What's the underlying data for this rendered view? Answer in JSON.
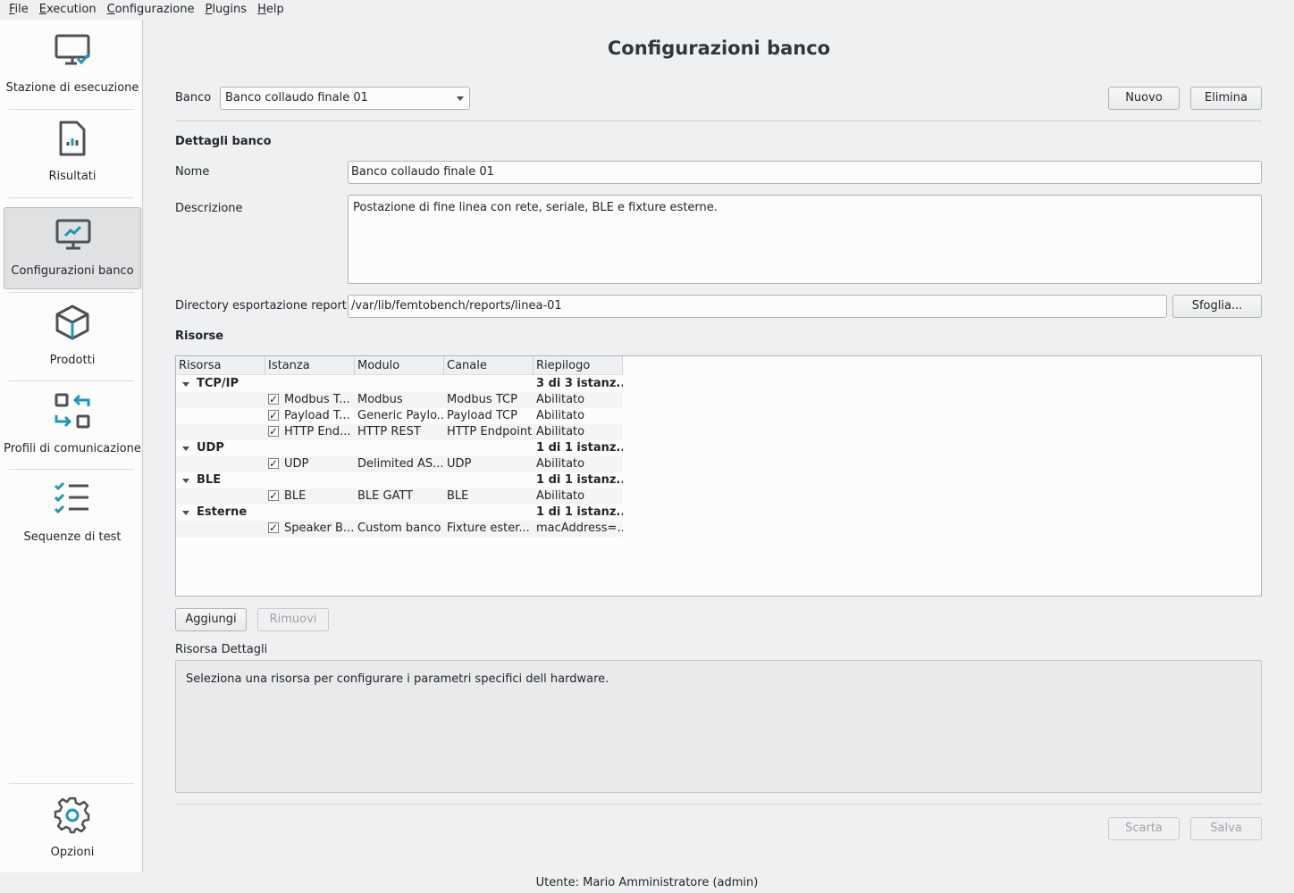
{
  "menu": [
    {
      "label": "File",
      "u": "F",
      "rest": "ile"
    },
    {
      "label": "Execution",
      "u": "E",
      "rest": "xecution"
    },
    {
      "label": "Configurazione",
      "u": "C",
      "rest": "onfigurazione"
    },
    {
      "label": "Plugins",
      "u": "P",
      "rest": "lugins"
    },
    {
      "label": "Help",
      "u": "H",
      "rest": "elp"
    }
  ],
  "sidebar": {
    "items": [
      {
        "label": "Stazione di esecuzione",
        "icon": "monitor-check-icon"
      },
      {
        "label": "Risultati",
        "icon": "report-chart-icon"
      },
      {
        "label": "Configurazioni banco",
        "icon": "monitor-chart-icon",
        "active": true
      },
      {
        "label": "Prodotti",
        "icon": "box-icon"
      },
      {
        "label": "Profili di comunicazione",
        "icon": "swap-arrows-icon"
      },
      {
        "label": "Sequenze di test",
        "icon": "checklist-icon"
      }
    ],
    "options": {
      "label": "Opzioni",
      "icon": "gear-icon"
    }
  },
  "main": {
    "title": "Configurazioni banco",
    "banco_label": "Banco",
    "banco_value": "Banco collaudo finale 01",
    "btn_new": "Nuovo",
    "btn_delete": "Elimina",
    "details_title": "Dettagli banco",
    "name_label": "Nome",
    "name_value": "Banco collaudo finale 01",
    "desc_label": "Descrizione",
    "desc_value": "Postazione di fine linea con rete, seriale, BLE e fixture esterne.",
    "export_label": "Directory esportazione report",
    "export_value": "/var/lib/femtobench/reports/linea-01",
    "btn_browse": "Sfoglia...",
    "resources_title": "Risorse",
    "columns": [
      "Risorsa",
      "Istanza",
      "Modulo",
      "Canale",
      "Riepilogo"
    ],
    "groups": [
      {
        "name": "TCP/IP",
        "summary": "3 di 3 istanz...",
        "children": [
          {
            "instance": "Modbus T...",
            "module": "Modbus",
            "channel": "Modbus TCP",
            "summary": "Abilitato"
          },
          {
            "instance": "Payload T...",
            "module": "Generic Paylo...",
            "channel": "Payload TCP",
            "summary": "Abilitato"
          },
          {
            "instance": "HTTP End...",
            "module": "HTTP REST",
            "channel": "HTTP Endpoint",
            "summary": "Abilitato"
          }
        ]
      },
      {
        "name": "UDP",
        "summary": "1 di 1 istanz...",
        "children": [
          {
            "instance": "UDP",
            "module": "Delimited AS...",
            "channel": "UDP",
            "summary": "Abilitato"
          }
        ]
      },
      {
        "name": "BLE",
        "summary": "1 di 1 istanz...",
        "children": [
          {
            "instance": "BLE",
            "module": "BLE GATT",
            "channel": "BLE",
            "summary": "Abilitato"
          }
        ]
      },
      {
        "name": "Esterne",
        "summary": "1 di 1 istanz...",
        "children": [
          {
            "instance": "Speaker B...",
            "module": "Custom banco",
            "channel": "Fixture ester...",
            "summary": "macAddress=..."
          }
        ]
      }
    ],
    "btn_add": "Aggiungi",
    "btn_remove": "Rimuovi",
    "res_details_label": "Risorsa Dettagli",
    "res_details_text": "Seleziona una risorsa per configurare i parametri specifici dell hardware.",
    "btn_discard": "Scarta",
    "btn_save": "Salva"
  },
  "status": "Utente: Mario Amministratore (admin)"
}
